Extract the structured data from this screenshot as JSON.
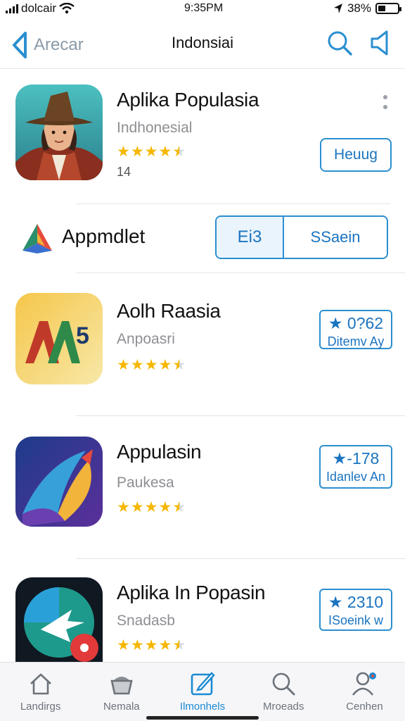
{
  "status_bar": {
    "carrier": "dolcair",
    "time": "9:35PM",
    "battery": "38%",
    "battery_level": 0.38
  },
  "nav": {
    "back_label": "Arecar",
    "title": "Indonsiai"
  },
  "featured": {
    "name": "Aplika Populasia",
    "subtitle": "Indhonesial",
    "rating": 4.5,
    "count": "14",
    "action_label": "Heuug"
  },
  "section": {
    "title": "Appmdlet",
    "segment_left": "Ei3",
    "segment_right": "SSaein"
  },
  "apps": [
    {
      "name": "Aolh Raasia",
      "subtitle": "Anpoasri",
      "rating": 4.5,
      "button_value": "★ 0?62",
      "button_label": "Ditemv Ay"
    },
    {
      "name": "Appulasin",
      "subtitle": "Paukesa",
      "rating": 4.5,
      "button_value": "★-178",
      "button_label": "Idanlev An"
    },
    {
      "name": "Aplika In Popasin",
      "subtitle": "Snadasb",
      "rating": 4.5,
      "button_value": "★ 2310",
      "button_label": "ISoeink w"
    }
  ],
  "tabs": [
    {
      "label": "Landirgs",
      "icon": "home-icon",
      "active": false
    },
    {
      "label": "Nemala",
      "icon": "basket-icon",
      "active": false
    },
    {
      "label": "Ilmonhels",
      "icon": "edit-icon",
      "active": true
    },
    {
      "label": "Mroeads",
      "icon": "search-icon",
      "active": false
    },
    {
      "label": "Cenhen",
      "icon": "profile-icon",
      "active": false
    }
  ],
  "colors": {
    "accent": "#1b8ad3",
    "star": "#f5b700",
    "outline": "#2b8fd0"
  }
}
